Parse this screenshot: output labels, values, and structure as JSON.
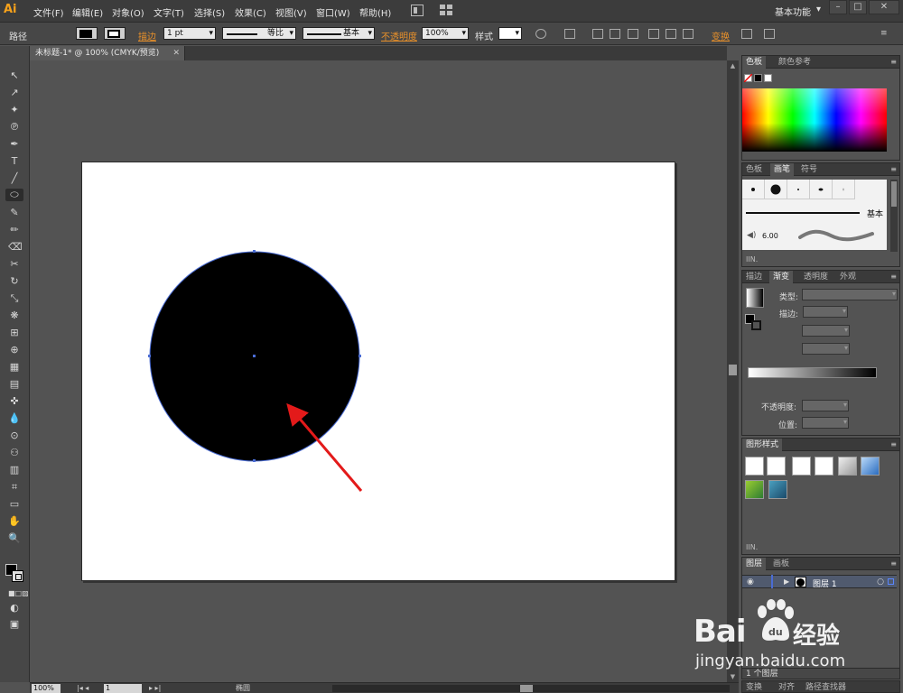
{
  "app": {
    "logo": "Ai",
    "menus": [
      "文件(F)",
      "编辑(E)",
      "对象(O)",
      "文字(T)",
      "选择(S)",
      "效果(C)",
      "视图(V)",
      "窗口(W)",
      "帮助(H)"
    ],
    "workspace": "基本功能",
    "window_buttons": [
      "–",
      "□",
      "✕"
    ],
    "workspace_arrow": "▾"
  },
  "control": {
    "selection_type": "路径",
    "stroke_label": "描边",
    "stroke_weight": "1 pt",
    "profile": "等比",
    "brush": "基本",
    "opacity_label": "不透明度",
    "opacity_value": "100%",
    "style_label": "样式",
    "transform_label": "变换"
  },
  "document": {
    "tab_title": "未标题-1* @ 100% (CMYK/预览)",
    "close": "✕"
  },
  "tools": [
    "↖",
    "↗",
    "✦",
    "℗",
    "✒",
    "T",
    "╱",
    "⬭",
    "✎",
    "✏",
    "⌫",
    "✂",
    "↻",
    "⤡",
    "❋",
    "⊞",
    "⊕",
    "▦",
    "▤",
    "✜",
    "▭",
    "💧",
    "⊙",
    "⚇",
    "▥",
    "⌗",
    "✋",
    "🔍"
  ],
  "status": {
    "zoom": "100%",
    "artboard_number": "1",
    "tool_name": "椭圆"
  },
  "panels": {
    "color": {
      "tabs": [
        "色板",
        "颜色参考"
      ],
      "active": "色板"
    },
    "brushes": {
      "tabs": [
        "色板",
        "画笔",
        "符号"
      ],
      "active": "画笔",
      "line_label": "基本",
      "size": "6.00"
    },
    "gradient": {
      "tabs": [
        "描边",
        "渐变",
        "透明度",
        "外观"
      ],
      "active": "渐变",
      "type_label": "类型:",
      "stroke_label": "描边:",
      "opacity_label": "不透明度:",
      "position_label": "位置:"
    },
    "graphic_styles": {
      "tabs": [
        "图形样式"
      ],
      "active": "图形样式"
    },
    "layers": {
      "tabs": [
        "图层",
        "画板"
      ],
      "active": "图层",
      "layer_name": "图层 1",
      "count_label": "1 个图层"
    },
    "bottom": {
      "tabs": [
        "变换",
        "对齐",
        "路径查找器"
      ]
    }
  },
  "watermark": {
    "brand": "Bai",
    "du": "du",
    "cn": "经验",
    "url": "jingyan.baidu.com"
  },
  "colors": {
    "menu_bg": "#3c3c3c",
    "panel_bg": "#535353",
    "accent_orange": "#e8902a",
    "selection_blue": "#4a6cd4",
    "arrow_red": "#e31a1a"
  }
}
